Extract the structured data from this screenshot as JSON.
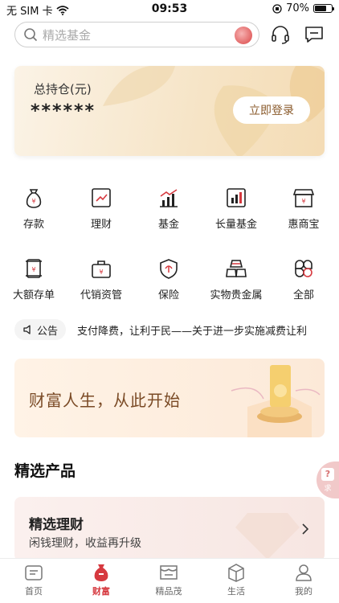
{
  "status_bar": {
    "carrier": "无 SIM 卡",
    "time": "09:53",
    "battery": "70%",
    "battery_level": 0.7
  },
  "search": {
    "placeholder": "精选基金",
    "brand_icon": "bank-logo-icon",
    "service_icon": "headset-icon",
    "message_icon": "message-icon"
  },
  "holdings": {
    "title": "总持仓(元)",
    "value": "******",
    "login_label": "立即登录"
  },
  "grid": {
    "items": [
      {
        "label": "存款",
        "icon": "money-bag-icon"
      },
      {
        "label": "理财",
        "icon": "chart-trend-icon"
      },
      {
        "label": "基金",
        "icon": "bar-growth-icon"
      },
      {
        "label": "长量基金",
        "icon": "bar-chart-icon"
      },
      {
        "label": "惠商宝",
        "icon": "store-icon"
      },
      {
        "label": "大额存单",
        "icon": "scroll-icon"
      },
      {
        "label": "代销资管",
        "icon": "briefcase-icon"
      },
      {
        "label": "保险",
        "icon": "shield-icon"
      },
      {
        "label": "实物贵金属",
        "icon": "gold-bars-icon"
      },
      {
        "label": "全部",
        "icon": "all-grid-icon"
      }
    ]
  },
  "notice": {
    "tag_label": "公告",
    "text": "支付降费，让利于民——关于进一步实施减费让利"
  },
  "banner": {
    "text": "财富人生，从此开始"
  },
  "section": {
    "title": "精选产品"
  },
  "product": {
    "title": "精选理财",
    "subtitle": "闲钱理财，收益再升级"
  },
  "float_button": {
    "label": "求"
  },
  "tabbar": {
    "items": [
      {
        "label": "首页",
        "icon": "home-icon",
        "active": false
      },
      {
        "label": "财富",
        "icon": "wealth-bag-icon",
        "active": true
      },
      {
        "label": "精品茂",
        "icon": "mall-icon",
        "active": false
      },
      {
        "label": "生活",
        "icon": "life-box-icon",
        "active": false
      },
      {
        "label": "我的",
        "icon": "profile-icon",
        "active": false
      }
    ]
  },
  "colors": {
    "accent": "#d6393f",
    "gold": "#8a5a2b"
  }
}
